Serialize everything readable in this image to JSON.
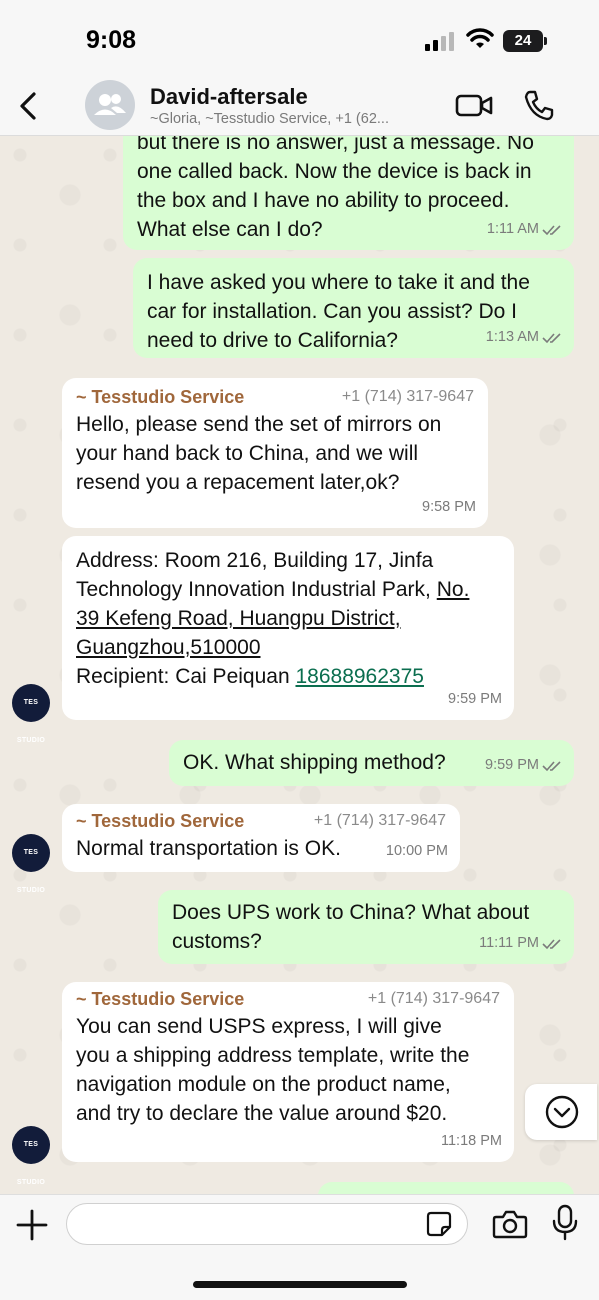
{
  "status": {
    "time": "9:08",
    "battery": "24"
  },
  "header": {
    "title": "David-aftersale",
    "subtitle": "~Gloria, ~Tesstudio Service, +1 (62..."
  },
  "messages": [
    {
      "direction": "out",
      "text_lines": [
        "but there is no answer, just a message. No",
        "one called back. Now the device is back in",
        "the box and I have no ability to proceed.",
        "What else can I do?"
      ],
      "time": "1:11 AM"
    },
    {
      "direction": "out",
      "text_lines": [
        "I have asked you where to take it and the",
        "car for installation. Can you assist?  Do I",
        "need to drive to California?"
      ],
      "time": "1:13 AM"
    },
    {
      "direction": "in",
      "sender": "~ Tesstudio Service",
      "phone": "+1 (714) 317-9647",
      "text_lines": [
        "Hello, please send the set of mirrors on",
        "your hand back to China, and we will",
        "resend you a repacement  later,ok?"
      ],
      "time": "9:58 PM"
    },
    {
      "direction": "in",
      "text_lines": [
        "Address: Room 216, Building 17, Jinfa",
        "Technology Innovation Industrial Park,"
      ],
      "underlined": [
        "No.",
        "39 Kefeng Road, Huangpu District,",
        "Guangzhou,510000"
      ],
      "recipient_label": "Recipient: Cai Peiquan",
      "recipient_phone": "18688962375",
      "time": "9:59 PM"
    },
    {
      "direction": "out",
      "text_lines": [
        "OK. What shipping method?"
      ],
      "time": "9:59 PM"
    },
    {
      "direction": "in",
      "sender": "~ Tesstudio Service",
      "phone": "+1 (714) 317-9647",
      "text_lines": [
        "Normal transportation is OK."
      ],
      "time": "10:00 PM"
    },
    {
      "direction": "out",
      "text_lines": [
        "Does UPS work to China?  What about",
        "customs?"
      ],
      "time": "11:11 PM"
    },
    {
      "direction": "in",
      "sender": "~ Tesstudio Service",
      "phone": "+1 (714) 317-9647",
      "text_lines": [
        "You can send USPS express, I will give",
        "you a shipping address template, write the",
        "navigation module on the product name,",
        "and try to declare the value around $20."
      ],
      "time": "11:18 PM"
    }
  ],
  "avatar_label": "TES STUDIO",
  "composer": {
    "placeholder": ""
  },
  "icons": [
    "back-arrow-icon",
    "group-icon",
    "video-call-icon",
    "phone-icon",
    "chevron-down-icon",
    "plus-icon",
    "sticker-icon",
    "camera-icon",
    "microphone-icon",
    "double-check-icon"
  ],
  "colors": {
    "outgoing": "#d9fdd3",
    "incoming": "#ffffff",
    "sender": "#a0673b",
    "link": "#0b6e4f",
    "background": "#efeae2"
  }
}
